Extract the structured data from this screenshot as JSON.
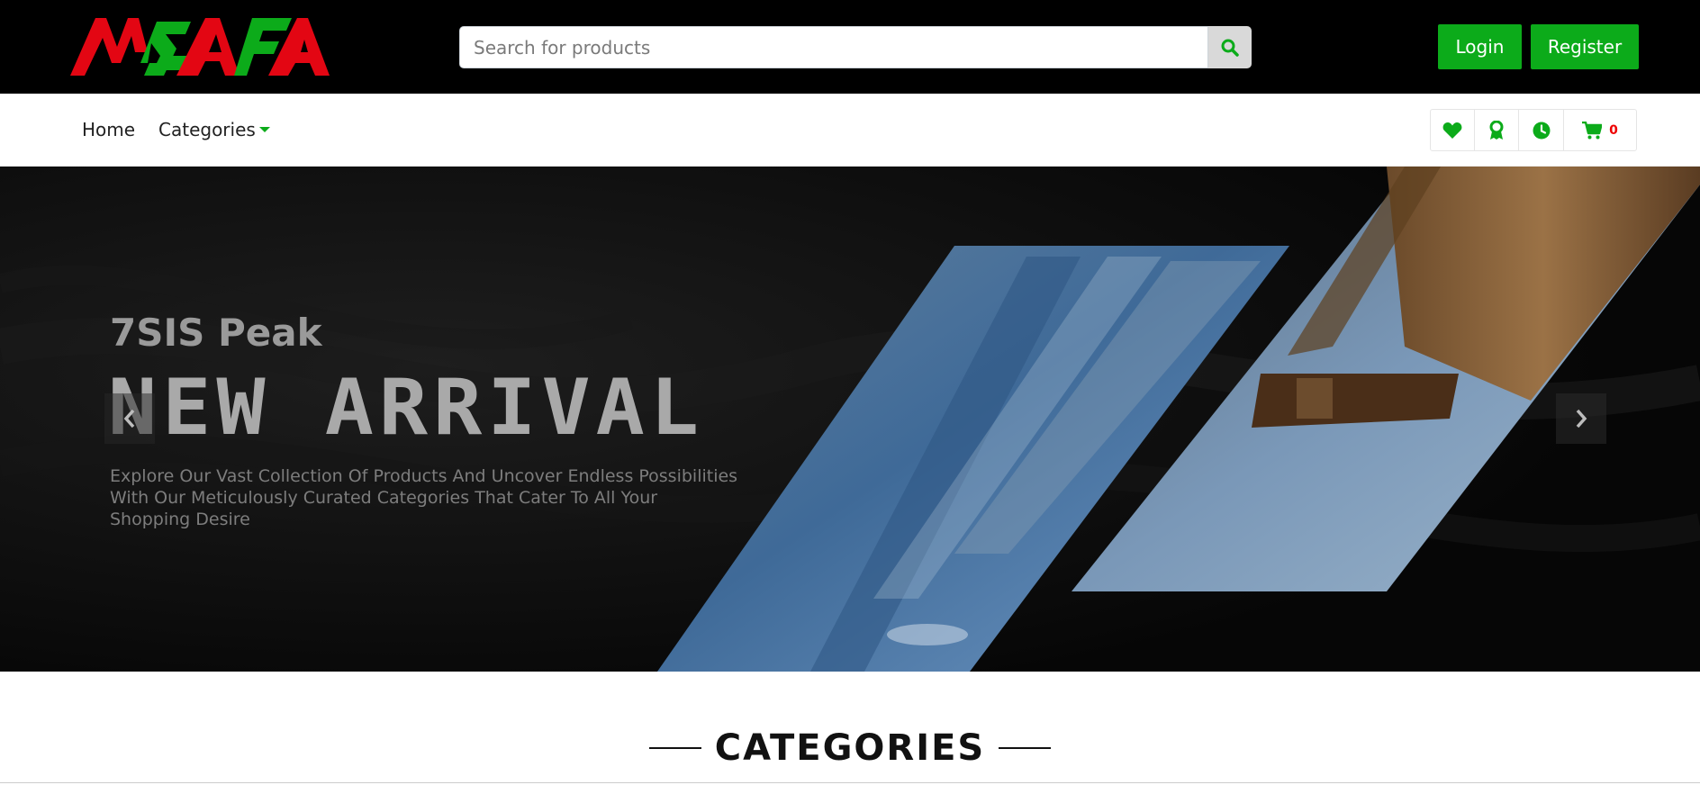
{
  "brand": {
    "logo_text": "MSAFA",
    "colors": {
      "red": "#e30613",
      "green": "#0cab1a"
    }
  },
  "search": {
    "placeholder": "Search for products",
    "button_icon": "search-icon"
  },
  "auth": {
    "login_label": "Login",
    "register_label": "Register"
  },
  "nav": {
    "items": [
      {
        "label": "Home"
      },
      {
        "label": "Categories"
      }
    ],
    "icons": [
      "heart-icon",
      "award-icon",
      "clock-icon",
      "cart-icon"
    ],
    "cart_count": "0"
  },
  "banner": {
    "subtitle": "7SIS Peak",
    "title": "NEW ARRIVAL",
    "description": "Explore Our Vast Collection Of Products And Uncover Endless Possibilities With Our Meticulously Curated Categories That Cater To All Your Shopping Desire"
  },
  "section": {
    "categories_title": "CATEGORIES"
  }
}
